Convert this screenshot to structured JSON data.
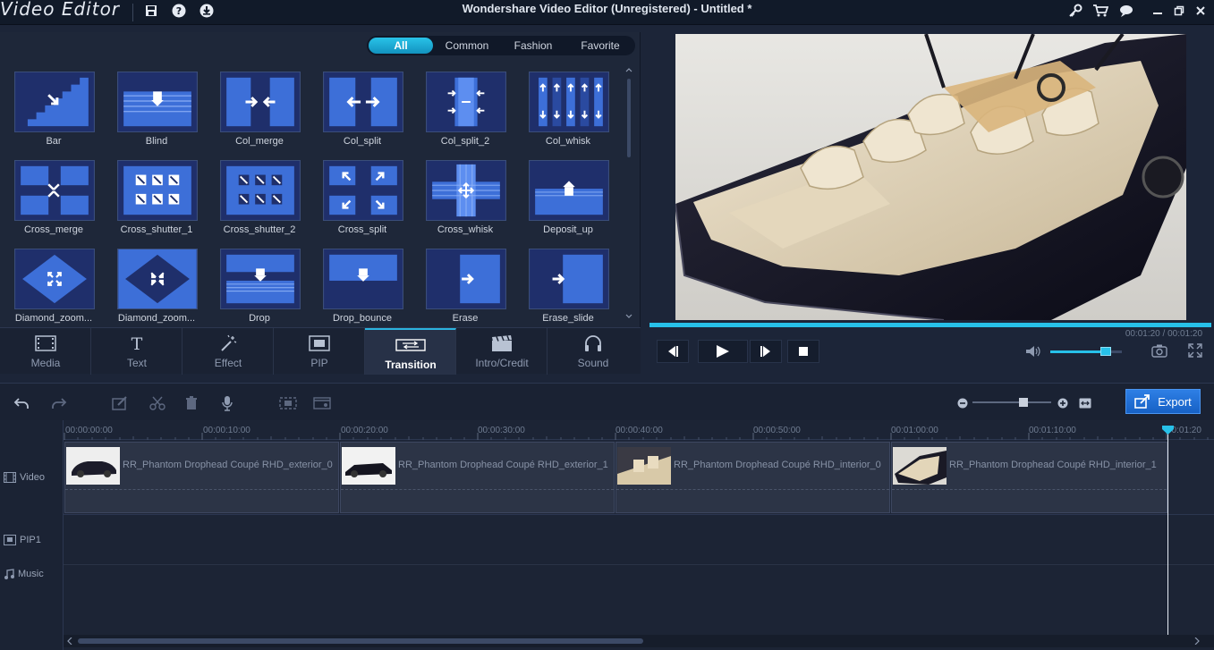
{
  "app": {
    "brand": "Video Editor",
    "window_title": "Wondershare Video Editor (Unregistered) - Untitled *"
  },
  "titlebar_icons": [
    "save-icon",
    "help-icon",
    "download-icon",
    "key-icon",
    "cart-icon",
    "chat-icon",
    "minimize-icon",
    "restore-icon",
    "close-icon"
  ],
  "filters": [
    {
      "label": "All",
      "active": true
    },
    {
      "label": "Common",
      "active": false
    },
    {
      "label": "Fashion",
      "active": false
    },
    {
      "label": "Favorite",
      "active": false
    }
  ],
  "transitions": [
    {
      "label": "Bar"
    },
    {
      "label": "Blind"
    },
    {
      "label": "Col_merge"
    },
    {
      "label": "Col_split"
    },
    {
      "label": "Col_split_2"
    },
    {
      "label": "Col_whisk"
    },
    {
      "label": "Cross_merge"
    },
    {
      "label": "Cross_shutter_1"
    },
    {
      "label": "Cross_shutter_2"
    },
    {
      "label": "Cross_split"
    },
    {
      "label": "Cross_whisk"
    },
    {
      "label": "Deposit_up"
    },
    {
      "label": "Diamond_zoom..."
    },
    {
      "label": "Diamond_zoom..."
    },
    {
      "label": "Drop"
    },
    {
      "label": "Drop_bounce"
    },
    {
      "label": "Erase"
    },
    {
      "label": "Erase_slide"
    }
  ],
  "tabs": [
    {
      "label": "Media",
      "icon": "film-icon",
      "active": false
    },
    {
      "label": "Text",
      "icon": "text-icon",
      "active": false
    },
    {
      "label": "Effect",
      "icon": "magic-wand-icon",
      "active": false
    },
    {
      "label": "PIP",
      "icon": "pip-icon",
      "active": false
    },
    {
      "label": "Transition",
      "icon": "transition-icon",
      "active": true
    },
    {
      "label": "Intro/Credit",
      "icon": "clapper-icon",
      "active": false
    },
    {
      "label": "Sound",
      "icon": "headphones-icon",
      "active": false
    }
  ],
  "player": {
    "time": "00:01:20 / 00:01:20",
    "progress": 1.0,
    "volume": 0.78
  },
  "timeline_toolbar": {
    "export_label": "Export",
    "zoom_level": 0.65
  },
  "timeline": {
    "ruler": [
      "00:00:00:00",
      "00:00:10:00",
      "00:00:20:00",
      "00:00:30:00",
      "00:00:40:00",
      "00:00:50:00",
      "00:01:00:00",
      "00:01:10:00",
      "00:01:20"
    ],
    "tracks": [
      "Video",
      "PIP1",
      "Music"
    ],
    "clips": [
      {
        "name": "RR_Phantom Drophead Coupé RHD_exterior_0"
      },
      {
        "name": "RR_Phantom Drophead Coupé RHD_exterior_1"
      },
      {
        "name": "RR_Phantom Drophead Coupé RHD_interior_0"
      },
      {
        "name": "RR_Phantom Drophead Coupé RHD_interior_1"
      }
    ]
  },
  "colors": {
    "accent": "#27c1e9",
    "export": "#1e6fd6",
    "tile_dark": "#1f2f6b",
    "tile_light": "#3d6fd8"
  }
}
